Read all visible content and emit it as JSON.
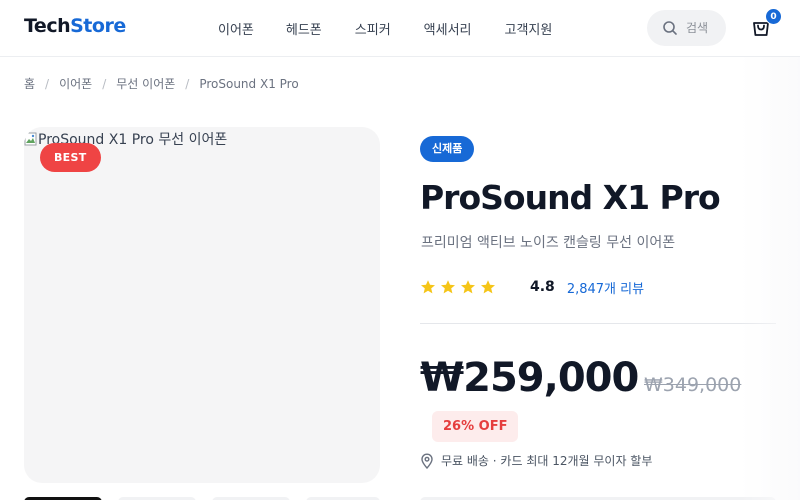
{
  "brand": {
    "logo_main": "Tech",
    "logo_accent": "Store",
    "accent_color": "#1769d6"
  },
  "nav": {
    "items": [
      {
        "label": "이어폰"
      },
      {
        "label": "헤드폰"
      },
      {
        "label": "스피커"
      },
      {
        "label": "액세서리"
      },
      {
        "label": "고객지원"
      }
    ]
  },
  "search": {
    "placeholder": "검색",
    "icon": "search-icon"
  },
  "cart": {
    "icon": "shopping-bag-icon",
    "count": "0"
  },
  "breadcrumb": {
    "items": [
      {
        "label": "홈"
      },
      {
        "label": "이어폰"
      },
      {
        "label": "무선 이어폰"
      },
      {
        "label": "ProSound X1 Pro"
      }
    ],
    "separator": "/"
  },
  "product": {
    "image_alt": "ProSound X1 Pro 무선 이어폰",
    "best_badge": "BEST",
    "new_badge": "신제품",
    "title": "ProSound X1 Pro",
    "subtitle": "프리미엄 액티브 노이즈 캔슬링 무선 이어폰",
    "rating": {
      "stars_filled": 4,
      "stars_total": 4,
      "value": "4.8",
      "reviews": "2,847개 리뷰"
    },
    "price": "₩259,000",
    "original_price": "₩349,000",
    "discount": "26% OFF",
    "shipping": "무료 배송 · 카드 최대 12개월 무이자 할부",
    "star_color": "#f5c518",
    "discount_color": "#e53e3e",
    "best_color": "#ef4444"
  }
}
